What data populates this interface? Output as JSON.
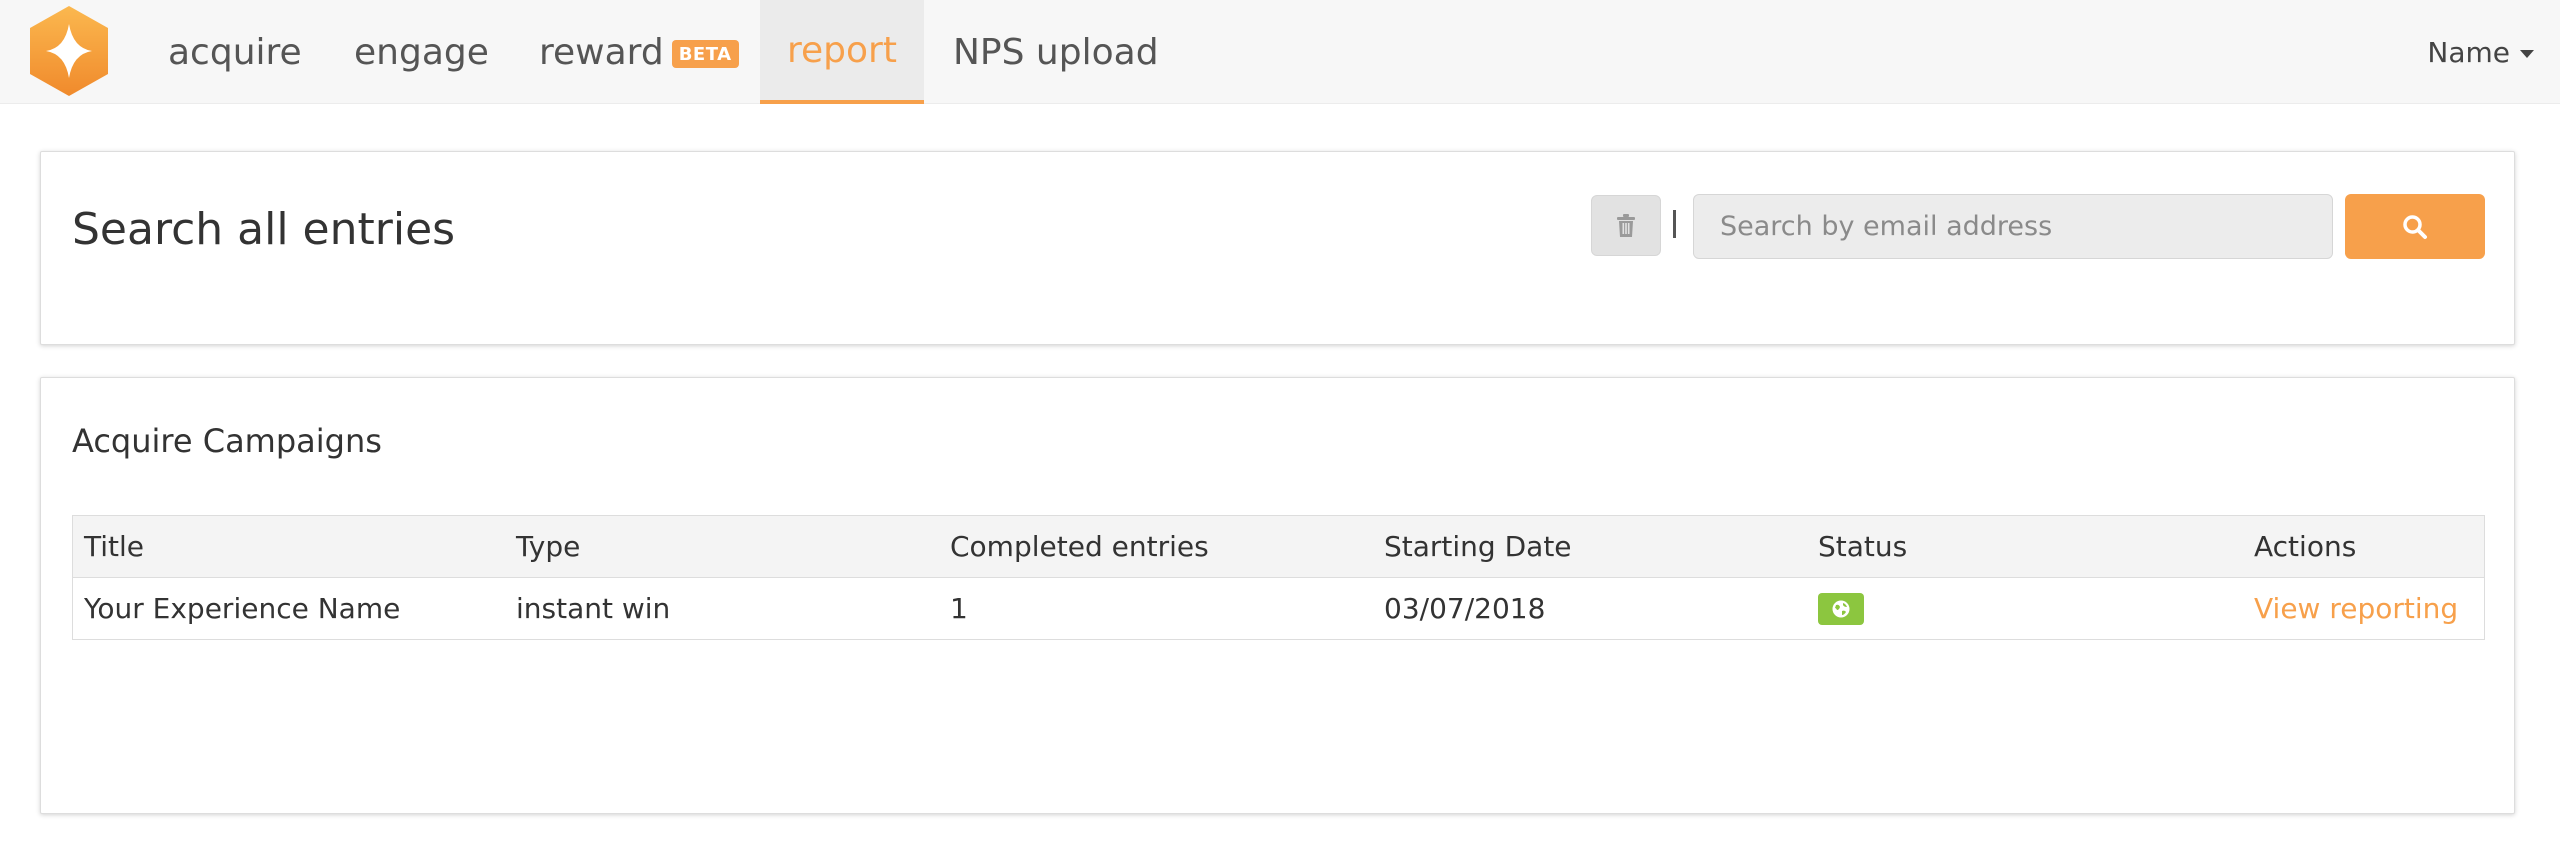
{
  "nav": {
    "items": [
      {
        "label": "acquire"
      },
      {
        "label": "engage"
      },
      {
        "label": "reward",
        "badge": "BETA"
      },
      {
        "label": "report"
      },
      {
        "label": "NPS upload"
      }
    ],
    "active": "report",
    "user": {
      "label": "Name"
    }
  },
  "search": {
    "title": "Search all entries",
    "placeholder": "Search by email address",
    "value": ""
  },
  "campaigns": {
    "title": "Acquire Campaigns",
    "columns": [
      "Title",
      "Type",
      "Completed entries",
      "Starting Date",
      "Status",
      "Actions"
    ],
    "rows": [
      {
        "title": "Your Experience Name",
        "type": "instant win",
        "completed": "1",
        "start_date": "03/07/2018",
        "status_icon": "globe-icon",
        "action": "View reporting"
      }
    ]
  },
  "colors": {
    "accent": "#f7a04b",
    "status_active": "#8cc63f",
    "nav_bg": "#f7f7f7"
  },
  "icons": {
    "logo": "star-hexagon-logo",
    "delete": "trash-icon",
    "search": "search-icon",
    "user_menu": "caret-down-icon"
  }
}
